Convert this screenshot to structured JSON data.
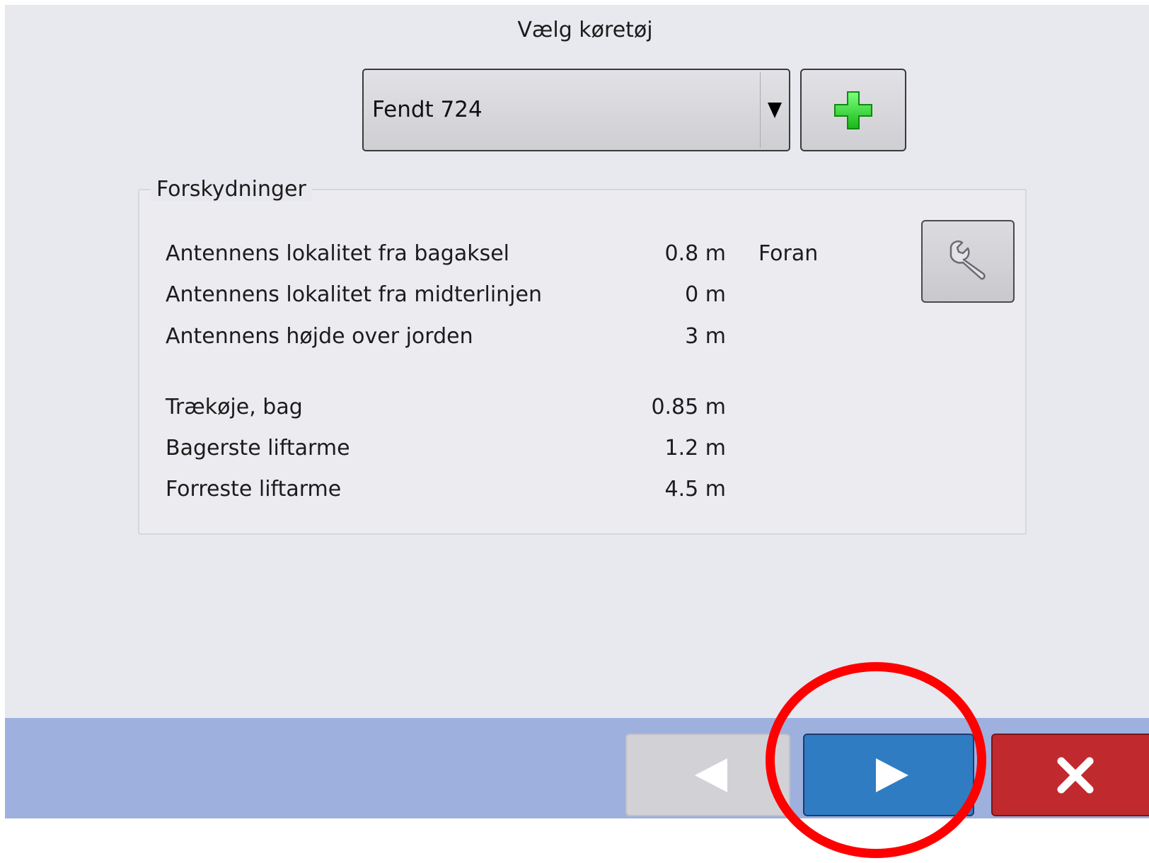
{
  "title": "Vælg køretøj",
  "vehicle_select": {
    "selected": "Fendt 724"
  },
  "offsets": {
    "legend": "Forskydninger",
    "rows": [
      {
        "label": "Antennens lokalitet fra bagaksel",
        "value": "0.8 m",
        "suffix": "Foran"
      },
      {
        "label": "Antennens lokalitet fra midterlinjen",
        "value": "0 m"
      },
      {
        "label": "Antennens højde over jorden",
        "value": "3 m"
      },
      {
        "label": "Trækøje, bag",
        "value": "0.85 m"
      },
      {
        "label": "Bagerste liftarme",
        "value": "1.2 m"
      },
      {
        "label": "Forreste liftarme",
        "value": "4.5 m"
      }
    ]
  },
  "icons": {
    "add": "plus-icon",
    "edit": "wrench-icon",
    "back": "arrow-left-icon",
    "next": "arrow-right-icon",
    "cancel": "close-icon",
    "dropdown": "triangle-down-icon"
  },
  "colors": {
    "background": "#e8e8ef",
    "bottom_bar": "#9eb0de",
    "next_button": "#2f7cc3",
    "cancel_button": "#c02a2e",
    "back_button_disabled": "#d2d2d6",
    "add_icon": "#2fd12f",
    "highlight": "#ff0000"
  }
}
